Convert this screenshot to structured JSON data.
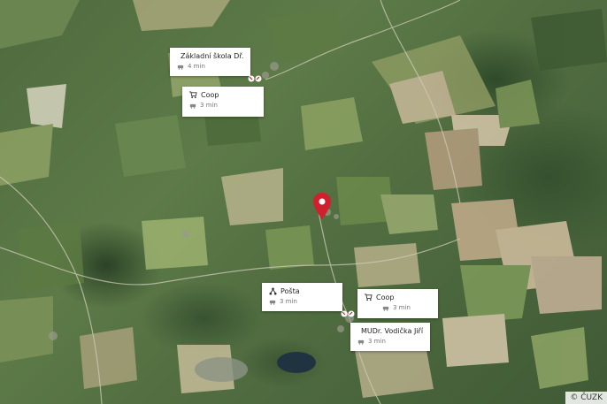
{
  "map": {
    "type": "satellite",
    "copyright": "© ČUZK"
  },
  "pois": [
    {
      "title": "Základní škola Dř...",
      "icon": "school-icon",
      "time": "4 min"
    },
    {
      "title": "Coop",
      "icon": "cart-icon",
      "time": "3 min"
    },
    {
      "title": "Pošta",
      "icon": "post-office-icon",
      "time": "3 min"
    },
    {
      "title": "Coop",
      "icon": "cart-icon",
      "time": "3 min"
    },
    {
      "title": "MUDr. Vodička Jiří",
      "icon": "doctor-icon",
      "time": "3 min"
    }
  ]
}
